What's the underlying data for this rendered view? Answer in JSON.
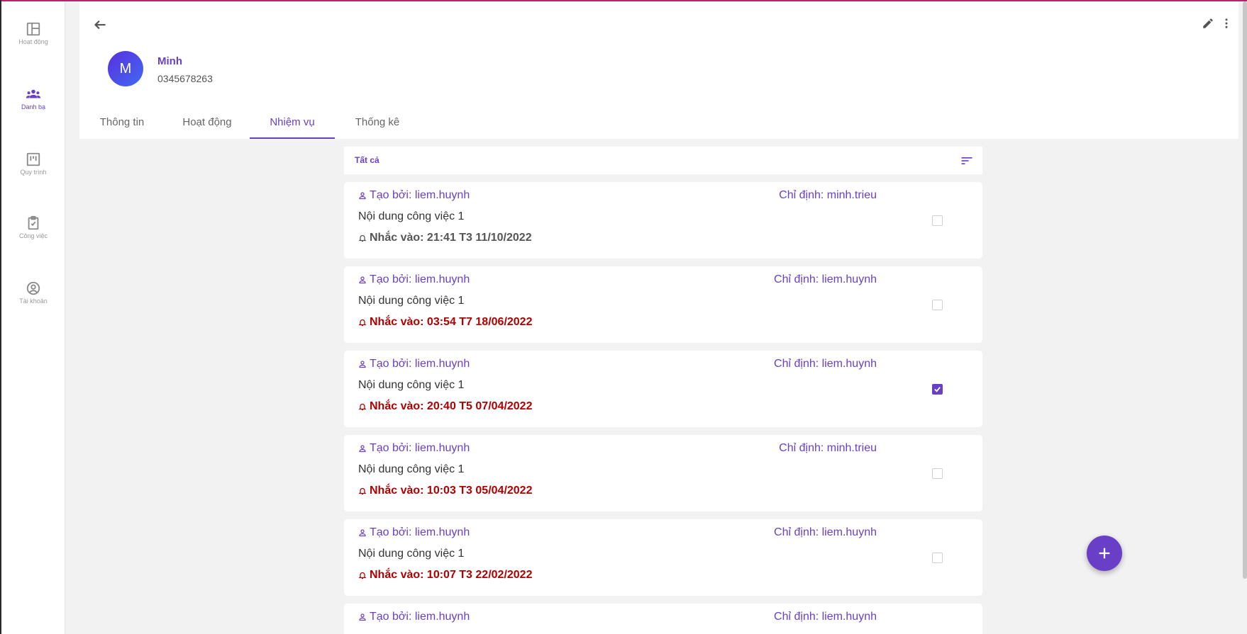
{
  "sidebar": {
    "items": [
      {
        "label": "Hoạt động",
        "icon": "dashboard-icon"
      },
      {
        "label": "Danh bạ",
        "icon": "contacts-icon"
      },
      {
        "label": "Quy trình",
        "icon": "kanban-icon"
      },
      {
        "label": "Công việc",
        "icon": "clipboard-check-icon"
      },
      {
        "label": "Tài khoản",
        "icon": "account-icon"
      }
    ]
  },
  "contact": {
    "initial": "M",
    "name": "Minh",
    "phone": "0345678263"
  },
  "tabs": [
    {
      "label": "Thông tin"
    },
    {
      "label": "Hoạt động"
    },
    {
      "label": "Nhiệm vụ"
    },
    {
      "label": "Thống kê"
    }
  ],
  "active_tab": "Nhiệm vụ",
  "filter": {
    "label": "Tất cả"
  },
  "tasks": [
    {
      "creator": "Tạo bởi: liem.huynh",
      "assignee": "Chỉ định: minh.trieu",
      "content": "Nội dung công việc 1",
      "reminder": "Nhắc vào: 21:41 T3 11/10/2022",
      "overdue": false,
      "checked": false
    },
    {
      "creator": "Tạo bởi: liem.huynh",
      "assignee": "Chỉ định: liem.huynh",
      "content": "Nội dung công việc 1",
      "reminder": "Nhắc vào: 03:54 T7 18/06/2022",
      "overdue": true,
      "checked": false
    },
    {
      "creator": "Tạo bởi: liem.huynh",
      "assignee": "Chỉ định: liem.huynh",
      "content": "Nội dung công việc 1",
      "reminder": "Nhắc vào: 20:40 T5 07/04/2022",
      "overdue": true,
      "checked": true
    },
    {
      "creator": "Tạo bởi: liem.huynh",
      "assignee": "Chỉ định: minh.trieu",
      "content": "Nội dung công việc 1",
      "reminder": "Nhắc vào: 10:03 T3 05/04/2022",
      "overdue": true,
      "checked": false
    },
    {
      "creator": "Tạo bởi: liem.huynh",
      "assignee": "Chỉ định: liem.huynh",
      "content": "Nội dung công việc 1",
      "reminder": "Nhắc vào: 10:07 T3 22/02/2022",
      "overdue": true,
      "checked": false
    },
    {
      "creator": "Tạo bởi: liem.huynh",
      "assignee": "Chỉ định: liem.huynh",
      "content": "",
      "reminder": "",
      "overdue": false,
      "checked": false
    }
  ],
  "colors": {
    "accent": "#6a3fc8",
    "overdue": "#b00000",
    "top_bar": "#b0276e"
  }
}
